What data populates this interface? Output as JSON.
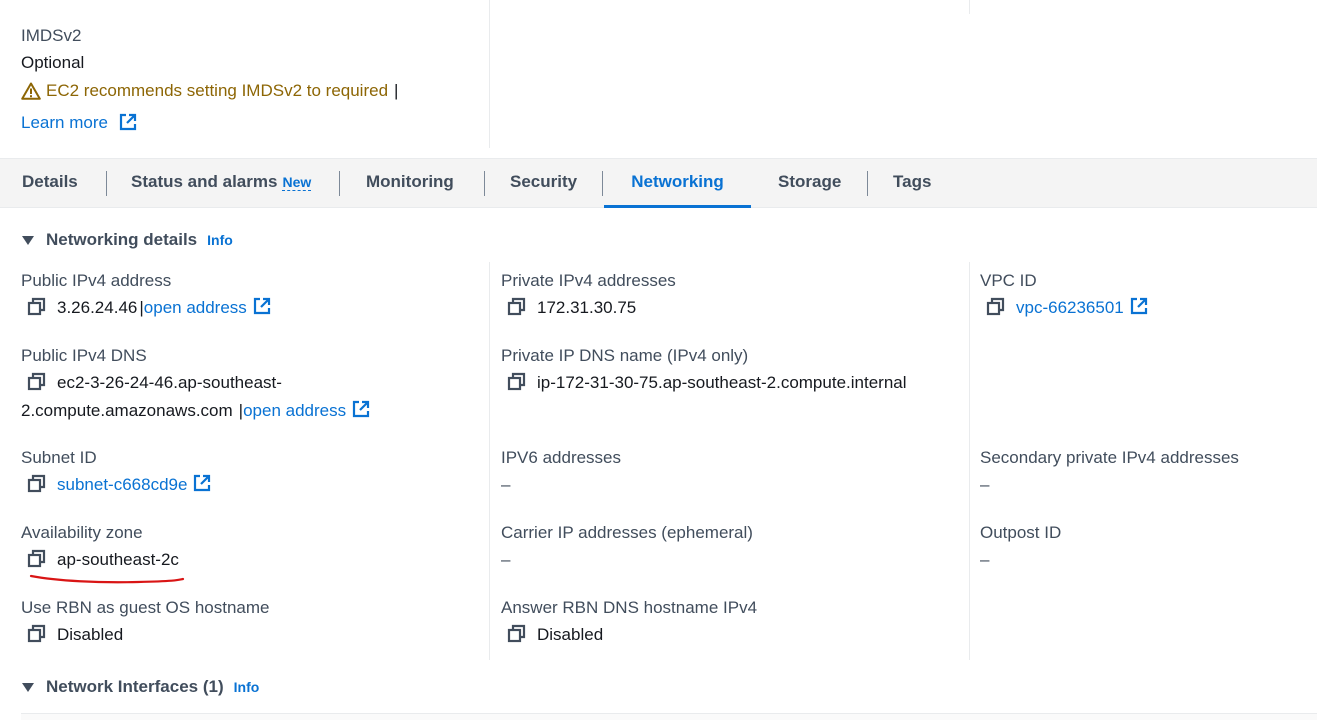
{
  "metadata_options": {
    "label": "IMDSv2",
    "value": "Optional",
    "warning": "EC2 recommends setting IMDSv2 to required",
    "warning_separator": "|",
    "learn_more": "Learn more"
  },
  "tabs": [
    {
      "label": "Details"
    },
    {
      "label": "Status and alarms",
      "badge": "New"
    },
    {
      "label": "Monitoring"
    },
    {
      "label": "Security"
    },
    {
      "label": "Networking",
      "active": true
    },
    {
      "label": "Storage"
    },
    {
      "label": "Tags"
    }
  ],
  "networking_details": {
    "title": "Networking details",
    "info": "Info",
    "public_ipv4": {
      "label": "Public IPv4 address",
      "value": "3.26.24.46",
      "separator": "|",
      "link": "open address"
    },
    "private_ipv4": {
      "label": "Private IPv4 addresses",
      "value": "172.31.30.75"
    },
    "vpc_id": {
      "label": "VPC ID",
      "value": "vpc-66236501"
    },
    "public_dns": {
      "label": "Public IPv4 DNS",
      "value_line1": "ec2-3-26-24-46.ap-southeast-",
      "value_line2": "2.compute.amazonaws.com",
      "separator": "|",
      "link": "open address"
    },
    "private_dns": {
      "label": "Private IP DNS name (IPv4 only)",
      "value": "ip-172-31-30-75.ap-southeast-2.compute.internal"
    },
    "subnet_id": {
      "label": "Subnet ID",
      "value": "subnet-c668cd9e"
    },
    "ipv6": {
      "label": "IPV6 addresses",
      "value": "–"
    },
    "secondary_private": {
      "label": "Secondary private IPv4 addresses",
      "value": "–"
    },
    "availability_zone": {
      "label": "Availability zone",
      "value": "ap-southeast-2c"
    },
    "carrier_ip": {
      "label": "Carrier IP addresses (ephemeral)",
      "value": "–"
    },
    "outpost_id": {
      "label": "Outpost ID",
      "value": "–"
    },
    "rbn_hostname": {
      "label": "Use RBN as guest OS hostname",
      "value": "Disabled"
    },
    "rbn_dns": {
      "label": "Answer RBN DNS hostname IPv4",
      "value": "Disabled"
    }
  },
  "network_interfaces": {
    "title": "Network Interfaces (1)",
    "info": "Info"
  },
  "colors": {
    "link": "#0972d3",
    "warning": "#8d6605",
    "annotation": "#d91515"
  },
  "icons": [
    "warning-icon",
    "external-link-icon",
    "copy-icon",
    "caret-down-icon"
  ]
}
